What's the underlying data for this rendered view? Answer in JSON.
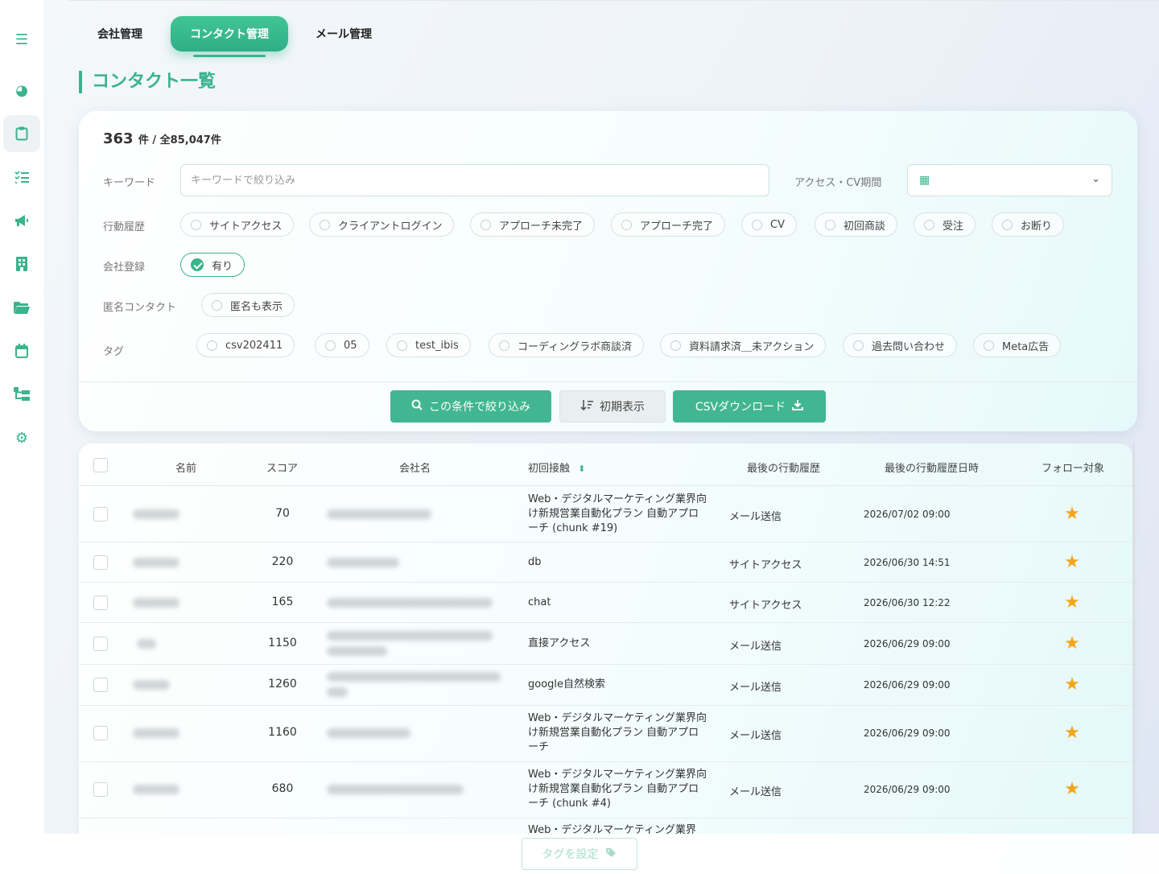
{
  "sidebar": {
    "icons": [
      "menu-icon",
      "dashboard-icon",
      "clipboard-icon",
      "checklist-icon",
      "megaphone-icon",
      "building-icon",
      "folder-icon",
      "calendar-icon",
      "sitemap-icon",
      "gear-icon"
    ]
  },
  "tabs": [
    {
      "label": "会社管理"
    },
    {
      "label": "コンタクト管理"
    },
    {
      "label": "メール管理"
    }
  ],
  "page_title": "コンタクト一覧",
  "summary": {
    "count": "363",
    "count_unit": "件 / 全85,047件"
  },
  "filters": {
    "keyword_label": "キーワード",
    "keyword_placeholder": "キーワードで絞り込み",
    "period_label": "アクセス・CV期間",
    "action_label": "行動履歴",
    "actions": [
      "サイトアクセス",
      "クライアントログイン",
      "アプローチ未完了",
      "アプローチ完了",
      "CV",
      "初回商談",
      "受注",
      "お断り"
    ],
    "company_label": "会社登録",
    "company_option": "有り",
    "anon_label": "匿名コンタクト",
    "anon_option": "匿名も表示",
    "tag_label": "タグ",
    "tags": [
      "csv202411",
      "05",
      "test_ibis",
      "コーディングラボ商談済",
      "資料請求済＿未アクション",
      "過去問い合わせ",
      "Meta広告"
    ]
  },
  "buttons": {
    "filter": "この条件で絞り込み",
    "reset": "初期表示",
    "csv": "CSVダウンロード"
  },
  "table": {
    "headers": [
      "名前",
      "スコア",
      "会社名",
      "初回接触",
      "最後の行動履歴",
      "最後の行動履歴日時",
      "フォロー対象"
    ],
    "rows": [
      {
        "score": "70",
        "first_contact": "Web・デジタルマーケティング業界向け新規営業自動化プラン 自動アプローチ (chunk #19)",
        "last_action": "メール送信",
        "last_date": "2026/07/02 09:00",
        "follow": true
      },
      {
        "score": "220",
        "first_contact": "db",
        "last_action": "サイトアクセス",
        "last_date": "2026/06/30 14:51",
        "follow": true
      },
      {
        "score": "165",
        "first_contact": "chat",
        "last_action": "サイトアクセス",
        "last_date": "2026/06/30 12:22",
        "follow": true
      },
      {
        "score": "1150",
        "first_contact": "直接アクセス",
        "last_action": "メール送信",
        "last_date": "2026/06/29 09:00",
        "follow": true
      },
      {
        "score": "1260",
        "first_contact": "google自然検索",
        "last_action": "メール送信",
        "last_date": "2026/06/29 09:00",
        "follow": true
      },
      {
        "score": "1160",
        "first_contact": "Web・デジタルマーケティング業界向け新規営業自動化プラン 自動アプローチ",
        "last_action": "メール送信",
        "last_date": "2026/06/29 09:00",
        "follow": true
      },
      {
        "score": "680",
        "first_contact": "Web・デジタルマーケティング業界向け新規営業自動化プラン 自動アプローチ (chunk #4)",
        "last_action": "メール送信",
        "last_date": "2026/06/29 09:00",
        "follow": true
      },
      {
        "score": "",
        "first_contact": "Web・デジタルマーケティング業界",
        "last_action": "",
        "last_date": "",
        "follow": false
      }
    ]
  },
  "footer": {
    "tag_button": "タグを設定"
  },
  "colors": {
    "accent": "#3bb38c",
    "star": "#f3a51a"
  }
}
